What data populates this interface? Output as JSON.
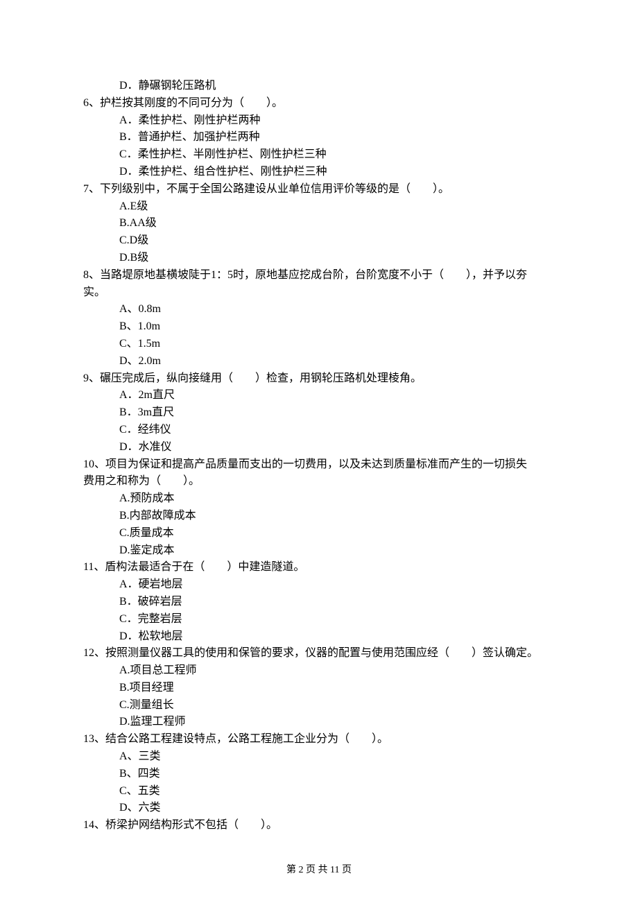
{
  "q5": {
    "optD": "D．静碾钢轮压路机"
  },
  "q6": {
    "stem": "6、护栏按其刚度的不同可分为（　　）。",
    "optA": "A．柔性护栏、刚性护栏两种",
    "optB": "B．普通护栏、加强护栏两种",
    "optC": "C．柔性护栏、半刚性护栏、刚性护栏三种",
    "optD": "D．柔性护栏、组合性护栏、刚性护栏三种"
  },
  "q7": {
    "stem": "7、下列级别中，不属于全国公路建设从业单位信用评价等级的是（　　）。",
    "optA": "A.E级",
    "optB": "B.AA级",
    "optC": "C.D级",
    "optD": "D.B级"
  },
  "q8": {
    "stem1": "8、当路堤原地基横坡陡于1：5时，原地基应挖成台阶，台阶宽度不小于（　　），并予以夯",
    "stem2": "实。",
    "optA": "A、0.8m",
    "optB": "B、1.0m",
    "optC": "C、1.5m",
    "optD": "D、2.0m"
  },
  "q9": {
    "stem": "9、碾压完成后，纵向接缝用（　　）检查，用钢轮压路机处理棱角。",
    "optA": "A．2m直尺",
    "optB": "B．3m直尺",
    "optC": "C．经纬仪",
    "optD": "D．水准仪"
  },
  "q10": {
    "stem1": "10、项目为保证和提高产品质量而支出的一切费用，以及未达到质量标准而产生的一切损失",
    "stem2": "费用之和称为（　　）。",
    "optA": "A.预防成本",
    "optB": "B.内部故障成本",
    "optC": "C.质量成本",
    "optD": "D.鉴定成本"
  },
  "q11": {
    "stem": "11、盾构法最适合于在（　　）中建造隧道。",
    "optA": "A．硬岩地层",
    "optB": "B．破碎岩层",
    "optC": "C．完整岩层",
    "optD": "D．松软地层"
  },
  "q12": {
    "stem": "12、按照测量仪器工具的使用和保管的要求，仪器的配置与使用范围应经（　　）签认确定。",
    "optA": "A.项目总工程师",
    "optB": "B.项目经理",
    "optC": "C.测量组长",
    "optD": "D.监理工程师"
  },
  "q13": {
    "stem": "13、结合公路工程建设特点，公路工程施工企业分为（　　）。",
    "optA": "A、三类",
    "optB": "B、四类",
    "optC": "C、五类",
    "optD": "D、六类"
  },
  "q14": {
    "stem": "14、桥梁护网结构形式不包括（　　）。"
  },
  "footer": "第 2 页 共 11 页"
}
